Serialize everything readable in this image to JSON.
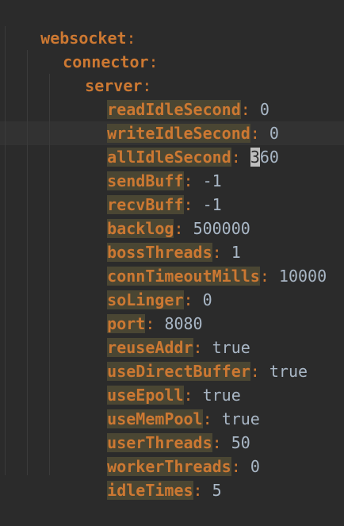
{
  "yaml": {
    "root_key": "websocket",
    "child_key": "connector",
    "server_key": "server",
    "settings": [
      {
        "key": "readIdleSecond",
        "value": "0"
      },
      {
        "key": "writeIdleSecond",
        "value": "0"
      },
      {
        "key": "allIdleSecond",
        "value": "360"
      },
      {
        "key": "sendBuff",
        "value": "-1"
      },
      {
        "key": "recvBuff",
        "value": "-1"
      },
      {
        "key": "backlog",
        "value": "500000"
      },
      {
        "key": "bossThreads",
        "value": "1"
      },
      {
        "key": "connTimeoutMills",
        "value": "10000"
      },
      {
        "key": "soLinger",
        "value": "0"
      },
      {
        "key": "port",
        "value": "8080"
      },
      {
        "key": "reuseAddr",
        "value": "true"
      },
      {
        "key": "useDirectBuffer",
        "value": "true"
      },
      {
        "key": "useEpoll",
        "value": "true"
      },
      {
        "key": "useMemPool",
        "value": "true"
      },
      {
        "key": "userThreads",
        "value": "50"
      },
      {
        "key": "workerThreads",
        "value": "0"
      },
      {
        "key": "idleTimes",
        "value": "5"
      }
    ],
    "colon": ":",
    "separator": ": "
  },
  "colors": {
    "background": "#2b2b2b",
    "current_line": "#323232",
    "key": "#cc7832",
    "value": "#a9b7c6",
    "highlight": "#4a4633",
    "caret": "#bfbfbf"
  }
}
